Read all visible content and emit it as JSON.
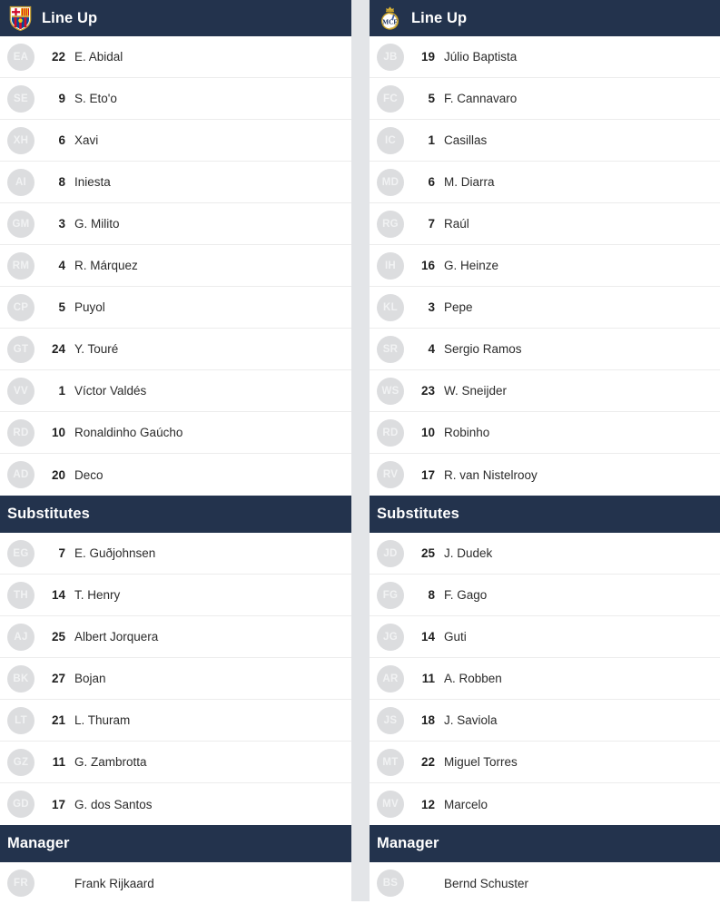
{
  "gutter_color": "#e3e5e8",
  "header_color": "#23334d",
  "avatar_color": "#dcdddf",
  "divider_color": "#ececec",
  "columns": [
    {
      "team": "fc-barcelona",
      "crest_name": "fc-barcelona-crest",
      "lineup": {
        "title": "Line Up",
        "players": [
          {
            "initials": "EA",
            "number": "22",
            "name": "E. Abidal"
          },
          {
            "initials": "SE",
            "number": "9",
            "name": "S. Eto'o"
          },
          {
            "initials": "XH",
            "number": "6",
            "name": "Xavi"
          },
          {
            "initials": "AI",
            "number": "8",
            "name": "Iniesta"
          },
          {
            "initials": "GM",
            "number": "3",
            "name": "G. Milito"
          },
          {
            "initials": "RM",
            "number": "4",
            "name": "R. Márquez"
          },
          {
            "initials": "CP",
            "number": "5",
            "name": "Puyol"
          },
          {
            "initials": "GT",
            "number": "24",
            "name": "Y. Touré"
          },
          {
            "initials": "VV",
            "number": "1",
            "name": "Víctor Valdés"
          },
          {
            "initials": "RD",
            "number": "10",
            "name": "Ronaldinho Gaúcho"
          },
          {
            "initials": "AD",
            "number": "20",
            "name": "Deco"
          }
        ]
      },
      "substitutes": {
        "title": "Substitutes",
        "players": [
          {
            "initials": "EG",
            "number": "7",
            "name": "E. Guðjohnsen"
          },
          {
            "initials": "TH",
            "number": "14",
            "name": "T. Henry"
          },
          {
            "initials": "AJ",
            "number": "25",
            "name": "Albert Jorquera"
          },
          {
            "initials": "BK",
            "number": "27",
            "name": "Bojan"
          },
          {
            "initials": "LT",
            "number": "21",
            "name": "L. Thuram"
          },
          {
            "initials": "GZ",
            "number": "11",
            "name": "G. Zambrotta"
          },
          {
            "initials": "GD",
            "number": "17",
            "name": "G. dos Santos"
          }
        ]
      },
      "manager": {
        "title": "Manager",
        "person": {
          "initials": "FR",
          "name": "Frank Rijkaard"
        }
      }
    },
    {
      "team": "real-madrid",
      "crest_name": "real-madrid-crest",
      "lineup": {
        "title": "Line Up",
        "players": [
          {
            "initials": "JB",
            "number": "19",
            "name": "Júlio Baptista"
          },
          {
            "initials": "FC",
            "number": "5",
            "name": "F. Cannavaro"
          },
          {
            "initials": "IC",
            "number": "1",
            "name": "Casillas"
          },
          {
            "initials": "MD",
            "number": "6",
            "name": "M. Diarra"
          },
          {
            "initials": "RG",
            "number": "7",
            "name": "Raúl"
          },
          {
            "initials": "IH",
            "number": "16",
            "name": "G. Heinze"
          },
          {
            "initials": "KL",
            "number": "3",
            "name": "Pepe"
          },
          {
            "initials": "SR",
            "number": "4",
            "name": "Sergio Ramos"
          },
          {
            "initials": "WS",
            "number": "23",
            "name": "W. Sneijder"
          },
          {
            "initials": "RD",
            "number": "10",
            "name": "Robinho"
          },
          {
            "initials": "RV",
            "number": "17",
            "name": "R. van Nistelrooy"
          }
        ]
      },
      "substitutes": {
        "title": "Substitutes",
        "players": [
          {
            "initials": "JD",
            "number": "25",
            "name": "J. Dudek"
          },
          {
            "initials": "FG",
            "number": "8",
            "name": "F. Gago"
          },
          {
            "initials": "JG",
            "number": "14",
            "name": "Guti"
          },
          {
            "initials": "AR",
            "number": "11",
            "name": "A. Robben"
          },
          {
            "initials": "JS",
            "number": "18",
            "name": "J. Saviola"
          },
          {
            "initials": "MT",
            "number": "22",
            "name": "Miguel Torres"
          },
          {
            "initials": "MV",
            "number": "12",
            "name": "Marcelo"
          }
        ]
      },
      "manager": {
        "title": "Manager",
        "person": {
          "initials": "BS",
          "name": "Bernd Schuster"
        }
      }
    }
  ]
}
